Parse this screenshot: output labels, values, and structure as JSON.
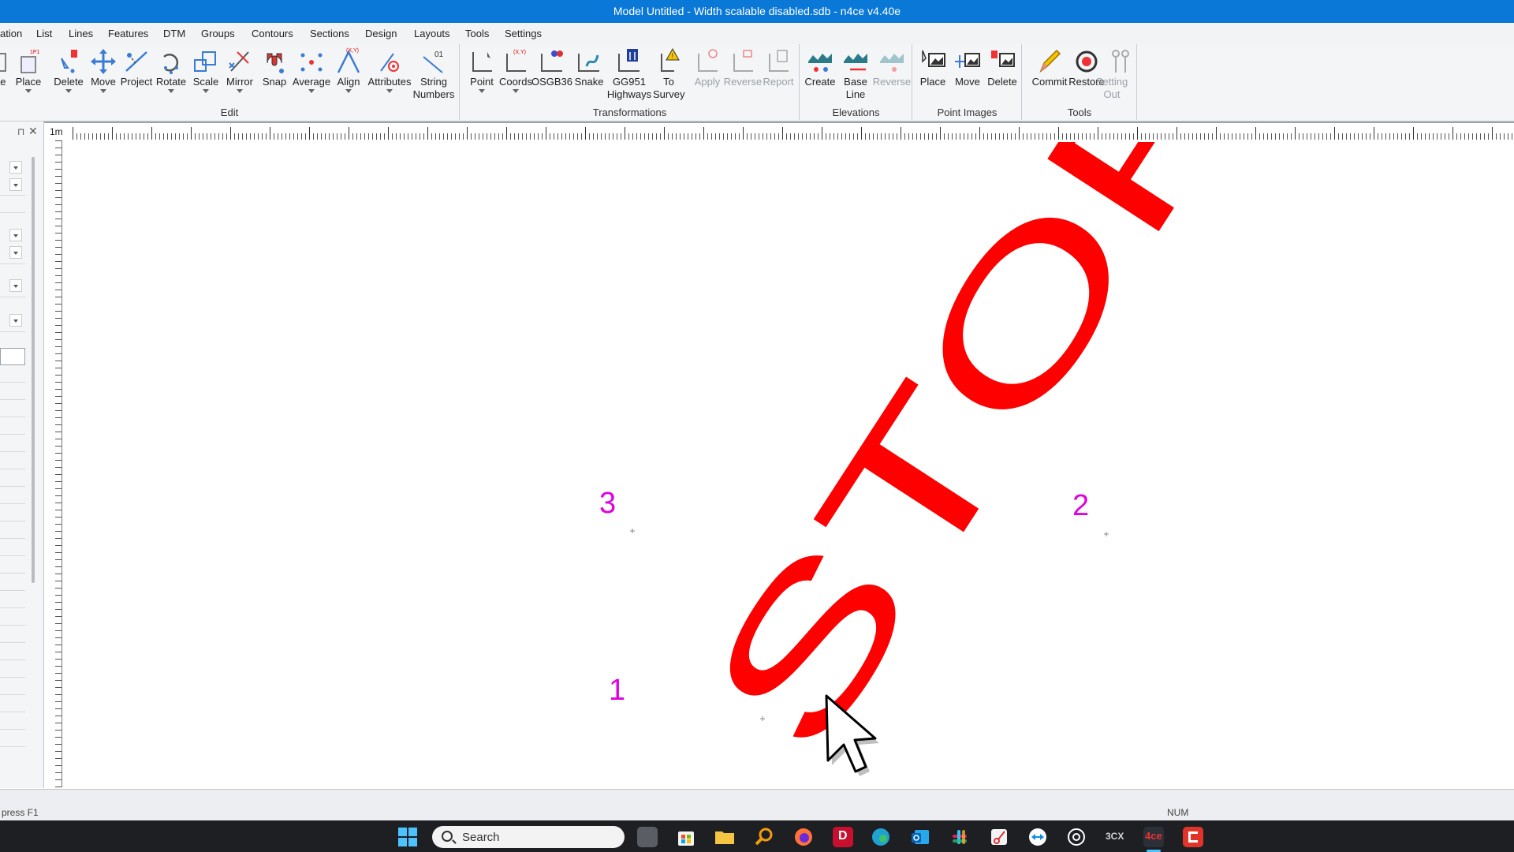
{
  "window": {
    "title": "Model Untitled - Width scalable disabled.sdb - n4ce v4.40e"
  },
  "menu": {
    "items": [
      "ation",
      "List",
      "Lines",
      "Features",
      "DTM",
      "Groups",
      "Contours",
      "Sections",
      "Design",
      "Layouts",
      "Tools",
      "Settings"
    ]
  },
  "ribbon": {
    "groups": {
      "edit": "Edit",
      "transformations": "Transformations",
      "elevations": "Elevations",
      "point_images": "Point Images",
      "tools": "Tools"
    },
    "buttons": {
      "te": "te",
      "place": "Place",
      "delete": "Delete",
      "move": "Move",
      "project": "Project",
      "rotate": "Rotate",
      "scale": "Scale",
      "mirror": "Mirror",
      "snap": "Snap",
      "average": "Average",
      "align": "Align",
      "attributes": "Attributes",
      "string_numbers": "String Numbers",
      "point": "Point",
      "coords": "Coords",
      "osgb36": "OSGB36",
      "snake": "Snake",
      "gg951": "GG951 Highways",
      "to_survey": "To Survey",
      "apply": "Apply",
      "reverse_t": "Reverse",
      "report": "Report",
      "create": "Create",
      "base_line": "Base Line",
      "reverse_e": "Reverse",
      "img_place": "Place",
      "img_move": "Move",
      "img_delete": "Delete",
      "commit": "Commit",
      "restore": "Restore",
      "setting_out": "Setting Out"
    },
    "icon_badges": {
      "place": "1P1",
      "coords": "(X,Y)",
      "align": "(X,Y)",
      "string_numbers": "01"
    }
  },
  "ruler": {
    "unit": "1m"
  },
  "drawing": {
    "text": "STOP",
    "text_color": "#ff0000",
    "point_color": "#e000e0",
    "points": [
      "1",
      "2",
      "3"
    ]
  },
  "status": {
    "left": "press F1",
    "right": "NUM"
  },
  "taskbar": {
    "search_placeholder": "Search",
    "apps": [
      "start-icon",
      "task-view-icon",
      "store-icon",
      "file-explorer-icon",
      "search-app-icon",
      "firefox-icon",
      "d-app-icon",
      "edge-icon",
      "outlook-icon",
      "slack-icon",
      "snipping-icon",
      "teamviewer-icon",
      "chatgpt-icon",
      "3cx-icon",
      "n4ce-icon",
      "red-app-icon"
    ],
    "labels": {
      "3cx": "3CX",
      "d": "D",
      "n4ce": "4ce"
    }
  }
}
